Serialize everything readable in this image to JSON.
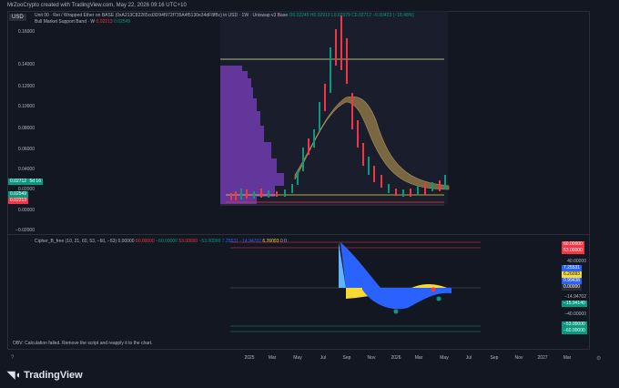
{
  "header": {
    "creator": "MrZooCrypto created with TradingView.com, May 22, 2026 09:16 UTC+10"
  },
  "currency": "USD",
  "legend": {
    "symbol_line": "Unit 00 · Rei / Wrapped Ether on BASE (0xA213C82265cd3D94f972f735A4f5130e34dF8fBc) in USD · 1W · Uniswap v3 Base",
    "ohlc": "O0.02249 H0.02913 L0.02079 C0.02712 −0.00423 (−18.48%)",
    "indicator": "Bull Market Support Band · W",
    "ind_v1": "0.02213",
    "ind_v2": "0.02549"
  },
  "price_axis": {
    "ticks": [
      "0.16000",
      "0.14000",
      "0.12000",
      "0.10000",
      "0.08000",
      "0.06000",
      "0.04000",
      "0.02000",
      "0.00000",
      "−0.02000"
    ],
    "boxes": [
      {
        "label": "0.02712",
        "sub": "5d 16",
        "color": "#089981"
      },
      {
        "label": "0.02549",
        "color": "#089981"
      },
      {
        "label": "0.02213",
        "color": "#f23645"
      }
    ]
  },
  "oscillator": {
    "title": "Cipher_B_free (10, 21, 60, 53, −60, −53)",
    "values": [
      {
        "text": "0.00000",
        "color": "#b2b5be"
      },
      {
        "text": "60.00000",
        "color": "#f23645"
      },
      {
        "text": "−60.00000",
        "color": "#089981"
      },
      {
        "text": "53.00000",
        "color": "#f23645"
      },
      {
        "text": "−53.00000",
        "color": "#089981"
      },
      {
        "text": "7.25531",
        "color": "#2962ff"
      },
      {
        "text": "−14.94702",
        "color": "#2962ff"
      },
      {
        "text": "6.26093",
        "color": "#f7d934"
      },
      {
        "text": "0",
        "color": "#b2b5be"
      },
      {
        "text": "0",
        "color": "#b2b5be"
      }
    ],
    "axis_boxes": [
      {
        "label": "60.00000",
        "color": "#f23645"
      },
      {
        "label": "53.00000",
        "color": "#f23645"
      },
      {
        "label": "40.00000",
        "color": "none"
      },
      {
        "label": "7.25531",
        "color": "#2962ff"
      },
      {
        "label": "6.26093",
        "color": "#f7d934"
      },
      {
        "label": "0.99438",
        "color": "#2962ff"
      },
      {
        "label": "0.00000",
        "color": "#2a2e39"
      },
      {
        "label": "−14.94702",
        "color": "none"
      },
      {
        "label": "−15.94140",
        "color": "#089981"
      },
      {
        "label": "−40.00000",
        "color": "none"
      },
      {
        "label": "−53.00000",
        "color": "#089981"
      },
      {
        "label": "−60.00000",
        "color": "#089981"
      }
    ]
  },
  "status_message": "OBV: Calculation failed. Remove the script and reapply it to the chart.",
  "time_axis": [
    "2025",
    "Mar",
    "May",
    "Jul",
    "Sep",
    "Nov",
    "2026",
    "Mar",
    "May",
    "Jul",
    "Sep",
    "Nov",
    "2027",
    "Mar"
  ],
  "branding": {
    "logo_text": "TradingView"
  },
  "colors": {
    "background": "#131722",
    "up": "#089981",
    "down": "#f23645",
    "band": "#c8a464",
    "grid": "#2a2e39"
  }
}
